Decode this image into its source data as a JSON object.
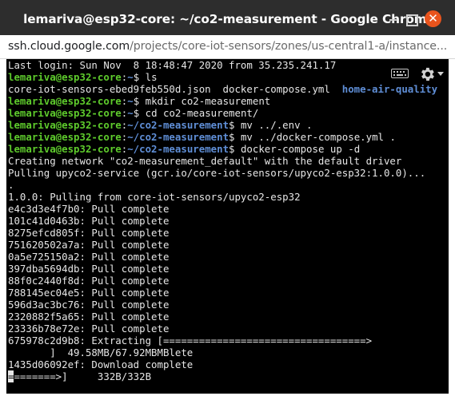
{
  "window": {
    "title": "lemariva@esp32-core: ~/co2-measurement - Google Chrome",
    "close_glyph": "✕"
  },
  "address": {
    "host": "ssh.cloud.google.com",
    "path": "/projects/core-iot-sensors/zones/us-central1-a/instance..."
  },
  "terminal": {
    "user_host": "lemariva@esp32-core",
    "lines": [
      {
        "type": "text",
        "text": "Last login: Sun Nov  8 18:48:47 2020 from 35.235.241.17"
      },
      {
        "type": "prompt",
        "path": "~",
        "cmd": "ls"
      },
      {
        "type": "listing",
        "files": "core-iot-sensors-ebed9feb550d.json  docker-compose.yml  ",
        "dir": "home-air-quality"
      },
      {
        "type": "prompt",
        "path": "~",
        "cmd": "mkdir co2-measurement"
      },
      {
        "type": "prompt",
        "path": "~",
        "cmd": "cd co2-measurement/"
      },
      {
        "type": "prompt",
        "path": "~/co2-measurement",
        "cmd": "mv ../.env ."
      },
      {
        "type": "prompt",
        "path": "~/co2-measurement",
        "cmd": "mv ../docker-compose.yml ."
      },
      {
        "type": "prompt",
        "path": "~/co2-measurement",
        "cmd": "docker-compose up -d"
      },
      {
        "type": "text",
        "text": "Creating network \"co2-measurement_default\" with the default driver"
      },
      {
        "type": "text",
        "text": "Pulling upyco2-service (gcr.io/core-iot-sensors/upyco2-esp32:1.0.0)..."
      },
      {
        "type": "text",
        "text": "."
      },
      {
        "type": "text",
        "text": "1.0.0: Pulling from core-iot-sensors/upyco2-esp32"
      },
      {
        "type": "text",
        "text": "e4c3d3e4f7b0: Pull complete"
      },
      {
        "type": "text",
        "text": "101c41d0463b: Pull complete"
      },
      {
        "type": "text",
        "text": "8275efcd805f: Pull complete"
      },
      {
        "type": "text",
        "text": "751620502a7a: Pull complete"
      },
      {
        "type": "text",
        "text": "0a5e725150a2: Pull complete"
      },
      {
        "type": "text",
        "text": "397dba5694db: Pull complete"
      },
      {
        "type": "text",
        "text": "88f0c2440f8d: Pull complete"
      },
      {
        "type": "text",
        "text": "788145ec04e5: Pull complete"
      },
      {
        "type": "text",
        "text": "596d3ac3bc76: Pull complete"
      },
      {
        "type": "text",
        "text": "2320882f5a65: Pull complete"
      },
      {
        "type": "text",
        "text": "23336b78e72e: Pull complete"
      },
      {
        "type": "text",
        "text": "675978c2d9b8: Extracting [==================================>"
      },
      {
        "type": "text",
        "text": "       ]  49.58MB/67.92MBMBlete"
      },
      {
        "type": "text",
        "text": "1435d06092ef: Download complete"
      },
      {
        "type": "cursor",
        "cursor_char": "=",
        "text": "=======>]     332B/332B"
      }
    ]
  },
  "toolbar": {
    "keyboard_icon": "keyboard-icon",
    "gear_icon": "gear-icon"
  },
  "colors": {
    "prompt_user": "#5ecb2c",
    "prompt_path": "#5f8ed6",
    "titlebar": "#2d2d2d",
    "close": "#e9541d"
  }
}
